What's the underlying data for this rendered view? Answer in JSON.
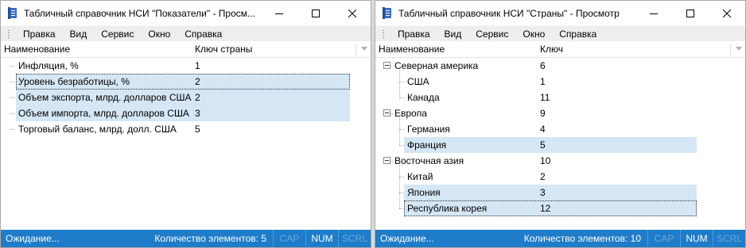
{
  "left_window": {
    "title": "Табличный справочник НСИ \"Показатели\" - Просм...",
    "menu": [
      "Правка",
      "Вид",
      "Сервис",
      "Окно",
      "Справка"
    ],
    "columns": {
      "name": "Наименование",
      "key": "Ключ страны"
    },
    "rows": [
      {
        "name": "Инфляция, %",
        "key": "1",
        "selected": false
      },
      {
        "name": "Уровень безработицы, %",
        "key": "2",
        "selected": true,
        "focused": true
      },
      {
        "name": "Объем экспорта, млрд. долларов США",
        "key": "2",
        "selected": true
      },
      {
        "name": "Объем импорта, млрд. долларов США",
        "key": "3",
        "selected": true
      },
      {
        "name": "Торговый баланс, млрд. долл. США",
        "key": "5",
        "selected": false
      }
    ],
    "status": {
      "text": "Ожидание...",
      "count": "Количество элементов: 5",
      "cap": "CAP",
      "num": "NUM",
      "scrl": "SCRL"
    }
  },
  "right_window": {
    "title": "Табличный справочник НСИ \"Страны\" - Просмотр",
    "menu": [
      "Правка",
      "Вид",
      "Сервис",
      "Окно",
      "Справка"
    ],
    "columns": {
      "name": "Наименование",
      "key": "Ключ"
    },
    "rows": [
      {
        "name": "Северная америка",
        "key": "6",
        "level": 0,
        "expanded": true
      },
      {
        "name": "США",
        "key": "1",
        "level": 1
      },
      {
        "name": "Канада",
        "key": "11",
        "level": 1
      },
      {
        "name": "Европа",
        "key": "9",
        "level": 0,
        "expanded": true
      },
      {
        "name": "Германия",
        "key": "4",
        "level": 1
      },
      {
        "name": "Франция",
        "key": "5",
        "level": 1,
        "selected": true
      },
      {
        "name": "Восточная азия",
        "key": "10",
        "level": 0,
        "expanded": true
      },
      {
        "name": "Китай",
        "key": "2",
        "level": 1
      },
      {
        "name": "Япония",
        "key": "3",
        "level": 1,
        "selected": true
      },
      {
        "name": "Республика корея",
        "key": "12",
        "level": 1,
        "selected": true,
        "focused": true
      }
    ],
    "status": {
      "text": "Ожидание...",
      "count": "Количество элементов: 10",
      "cap": "CAP",
      "num": "NUM",
      "scrl": "SCRL"
    }
  },
  "colors": {
    "status_bar": "#1e7cc9",
    "selection": "#d5e6f4",
    "menu_bg": "#eeeeee"
  },
  "icons": [
    "app-document-icon",
    "minimize-icon",
    "maximize-icon",
    "close-icon",
    "collapse-icon"
  ]
}
